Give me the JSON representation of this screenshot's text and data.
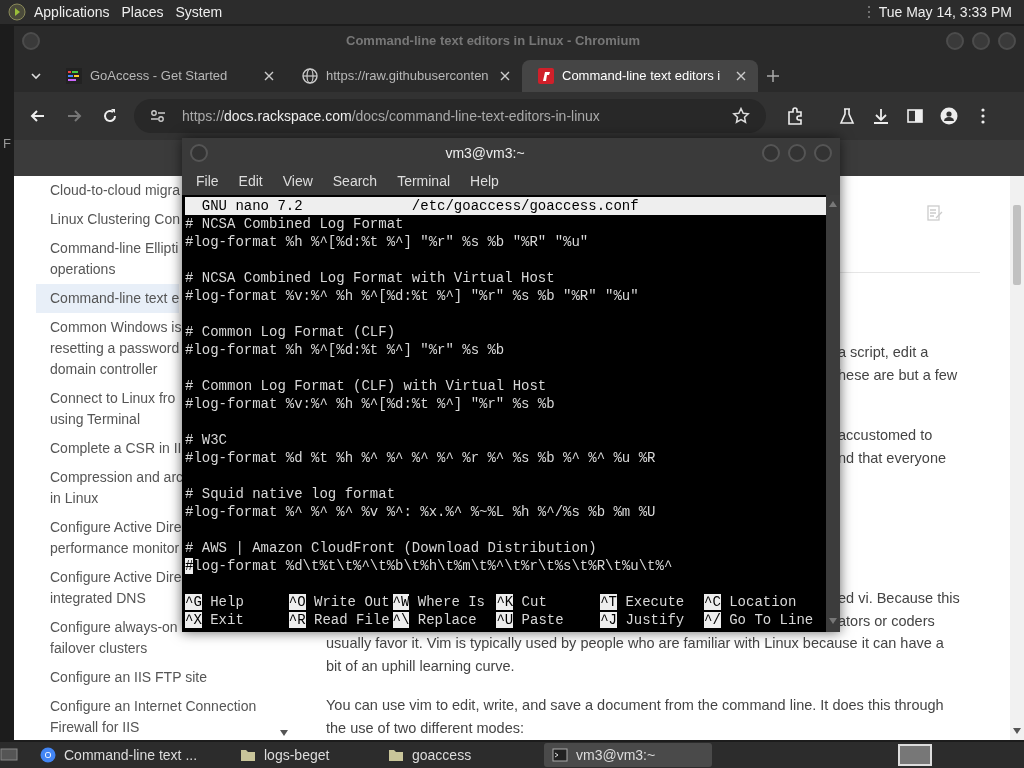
{
  "top_panel": {
    "menus": [
      "Applications",
      "Places",
      "System"
    ],
    "clock": "Tue May 14,  3:33 PM"
  },
  "desktop_label": "F",
  "browser": {
    "title": "Command-line text editors in Linux - Chromium",
    "tabs": [
      {
        "title": "GoAccess - Get Started",
        "selected": false
      },
      {
        "title": "https://raw.githubuserconten",
        "selected": false
      },
      {
        "title": "Command-line text editors i",
        "selected": true
      }
    ],
    "back": {
      "disabled": false
    },
    "forward": {
      "disabled": true
    },
    "address": {
      "scheme": "https://",
      "host": "docs.rackspace.com",
      "path": "/docs/command-line-text-editors-in-linux"
    },
    "sidebar": {
      "items": [
        {
          "lines": [
            "Cloud-to-cloud migra"
          ],
          "selected": false
        },
        {
          "lines": [
            "Linux Clustering Con"
          ],
          "selected": false
        },
        {
          "lines": [
            "Command-line Ellipti",
            "operations"
          ],
          "selected": false
        },
        {
          "lines": [
            "Command-line text e"
          ],
          "selected": true
        },
        {
          "lines": [
            "Common Windows is",
            "resetting a password",
            "domain controller"
          ],
          "selected": false
        },
        {
          "lines": [
            "Connect to Linux fro",
            "using Terminal"
          ],
          "selected": false
        },
        {
          "lines": [
            "Complete a CSR in II"
          ],
          "selected": false
        },
        {
          "lines": [
            "Compression and arc",
            "in Linux"
          ],
          "selected": false
        },
        {
          "lines": [
            "Configure Active Dire",
            "performance monitor"
          ],
          "selected": false
        },
        {
          "lines": [
            "Configure Active Dire",
            "integrated DNS"
          ],
          "selected": false
        },
        {
          "lines": [
            "Configure always-on",
            "failover clusters"
          ],
          "selected": false
        },
        {
          "lines": [
            "Configure an IIS FTP site"
          ],
          "selected": false
        },
        {
          "lines": [
            "Configure an Internet Connection",
            "Firewall for IIS"
          ],
          "selected": false
        }
      ]
    },
    "article": {
      "paragraphs": [
        {
          "lines": [
            {
              "kind": "partial",
              "text": "a script, edit a"
            },
            {
              "kind": "partial",
              "text": "hese are but a few"
            }
          ]
        },
        {
          "lines": [
            {
              "kind": "partial",
              "text": "accustomed to"
            },
            {
              "kind": "partial",
              "text": "nd that everyone"
            }
          ]
        },
        {
          "lines": [
            {
              "kind": "partial",
              "text": "ed vi. Because this"
            },
            {
              "kind": "partial",
              "text": "ators or coders"
            },
            {
              "kind": "full",
              "text": "usually favor it. Vim is typically used by people who are familiar with Linux because it can have a"
            },
            {
              "kind": "full",
              "text": "bit of an uphill learning curve."
            }
          ]
        },
        {
          "lines": [
            {
              "kind": "full",
              "text": "You can use vim to edit, write, and save a document from the command line. It does this through"
            },
            {
              "kind": "full",
              "text": "the use of two different modes:"
            }
          ]
        }
      ]
    }
  },
  "terminal": {
    "title": "vm3@vm3:~",
    "menus": [
      "File",
      "Edit",
      "View",
      "Search",
      "Terminal",
      "Help"
    ],
    "nano": {
      "version": "GNU nano 7.2",
      "file": "/etc/goaccess/goaccess.conf",
      "blocks": [
        {
          "comment": "# NCSA Combined Log Format",
          "directive": "#log-format %h %^[%d:%t %^] \"%r\" %s %b \"%R\" \"%u\""
        },
        {
          "comment": "# NCSA Combined Log Format with Virtual Host",
          "directive": "#log-format %v:%^ %h %^[%d:%t %^] \"%r\" %s %b \"%R\" \"%u\""
        },
        {
          "comment": "# Common Log Format (CLF)",
          "directive": "#log-format %h %^[%d:%t %^] \"%r\" %s %b"
        },
        {
          "comment": "# Common Log Format (CLF) with Virtual Host",
          "directive": "#log-format %v:%^ %h %^[%d:%t %^] \"%r\" %s %b"
        },
        {
          "comment": "# W3C",
          "directive": "#log-format %d %t %h %^ %^ %^ %^ %r %^ %s %b %^ %^ %u %R"
        },
        {
          "comment": "# Squid native log format",
          "directive": "#log-format %^ %^ %^ %v %^: %x.%^ %~%L %h %^/%s %b %m %U"
        },
        {
          "comment": "# AWS | Amazon CloudFront (Download Distribution)",
          "directive": "#log-format %d\\t%t\\t%^\\t%b\\t%h\\t%m\\t%^\\t%r\\t%s\\t%R\\t%u\\t%^",
          "cursor": true
        }
      ],
      "shortcuts": [
        {
          "key": "^G",
          "label": "Help"
        },
        {
          "key": "^O",
          "label": "Write Out"
        },
        {
          "key": "^W",
          "label": "Where Is"
        },
        {
          "key": "^K",
          "label": "Cut"
        },
        {
          "key": "^T",
          "label": "Execute"
        },
        {
          "key": "^C",
          "label": "Location"
        },
        {
          "key": "^X",
          "label": "Exit"
        },
        {
          "key": "^R",
          "label": "Read File"
        },
        {
          "key": "^\\",
          "label": "Replace"
        },
        {
          "key": "^U",
          "label": "Paste"
        },
        {
          "key": "^J",
          "label": "Justify"
        },
        {
          "key": "^/",
          "label": "Go To Line"
        }
      ]
    }
  },
  "taskbar": {
    "items": [
      {
        "label": "Command-line text ...",
        "kind": "browser",
        "selected": false
      },
      {
        "label": "logs-beget",
        "kind": "folder",
        "selected": false
      },
      {
        "label": "goaccess",
        "kind": "folder",
        "selected": false
      },
      {
        "label": "vm3@vm3:~",
        "kind": "terminal",
        "selected": true
      }
    ]
  }
}
